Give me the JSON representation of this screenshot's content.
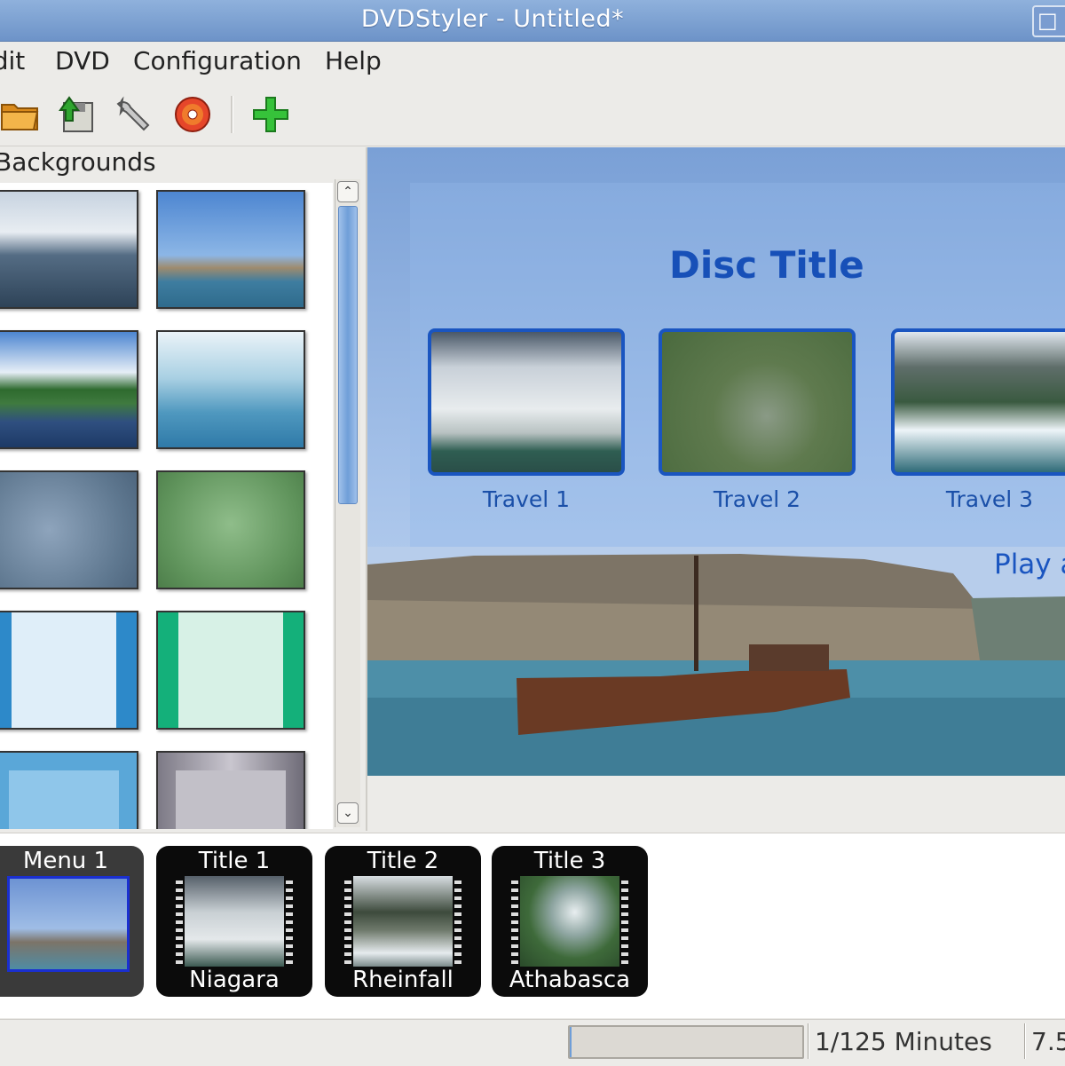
{
  "window": {
    "title": "DVDStyler - Untitled*",
    "control_glyph": "□"
  },
  "menu": {
    "items": [
      "Edit",
      "DVD",
      "Configuration",
      "Help"
    ]
  },
  "toolbar": {
    "icons": [
      "open-folder-icon",
      "save-icon",
      "settings-wrench-icon",
      "burn-disc-icon",
      "add-icon"
    ]
  },
  "backgrounds_panel": {
    "title": "Backgrounds",
    "thumbnails": [
      "sea-cloudy",
      "sea-island-boat",
      "lake-shore-trees",
      "blue-hills-rays",
      "blue-cloud-blur",
      "green-cloud-blur",
      "light-blue-stripes",
      "light-green-stripes",
      "blue-frame",
      "gray-frame"
    ],
    "scroll_up_glyph": "⌃",
    "scroll_down_glyph": "⌄"
  },
  "menu_preview": {
    "disc_title": "Disc Title",
    "buttons": [
      {
        "label": "Travel 1"
      },
      {
        "label": "Travel 2"
      },
      {
        "label": "Travel 3"
      }
    ],
    "play_all": "Play all"
  },
  "titleset": {
    "items": [
      {
        "top": "Menu 1",
        "bottom": "",
        "selected": true
      },
      {
        "top": "Title 1",
        "bottom": "Niagara",
        "selected": false
      },
      {
        "top": "Title 2",
        "bottom": "Rheinfall",
        "selected": false
      },
      {
        "top": "Title 3",
        "bottom": "Athabasca",
        "selected": false
      }
    ]
  },
  "status": {
    "progress_fraction": 0.008,
    "duration": "1/125 Minutes",
    "size": "7.5"
  },
  "colors": {
    "accent": "#1a55c0",
    "titlebar": "#7b9fd2"
  }
}
